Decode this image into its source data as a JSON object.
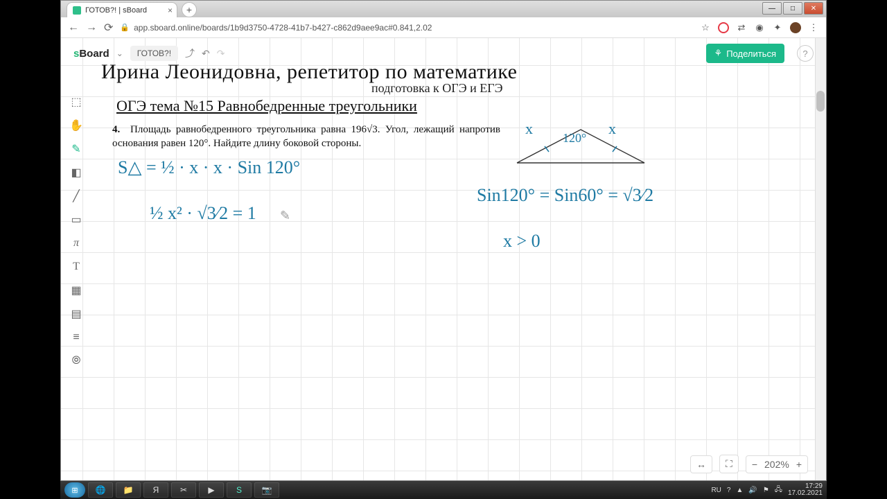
{
  "browser": {
    "tab_title": "ГОТОВ?! | sBoard",
    "url": "app.sboard.online/boards/1b9d3750-4728-41b7-b427-c862d9aee9ac#0.841,2.02"
  },
  "app": {
    "logo_prefix": "s",
    "logo": "Board",
    "project_name": "ГОТОВ?!",
    "share_label": "Поделиться",
    "help": "?",
    "zoom_label": "202%"
  },
  "header": {
    "title": "Ирина Леонидовна, репетитор по математике",
    "subtitle": "подготовка к ОГЭ и ЕГЭ",
    "topic": "ОГЭ тема №15 Равнобедренные треугольники"
  },
  "problem": {
    "num": "4.",
    "text_before": "Площадь равнобедренного треугольника равна 196",
    "sqrt": "√3",
    "text_after": ". Угол, лежащий напротив основания равен 120°. Найдите длину боковой стороны."
  },
  "handwriting": {
    "eq1": "S△ = ½ · x · x · Sin 120°",
    "eq2": "½ x² · √3⁄2 = 1",
    "eq3": "Sin120° = Sin60° = √3⁄2",
    "eq4": "x > 0",
    "tri_left": "x",
    "tri_right": "x",
    "tri_angle": "120°"
  },
  "taskbar": {
    "lang": "RU",
    "time": "17:29",
    "date": "17.02.2021"
  }
}
